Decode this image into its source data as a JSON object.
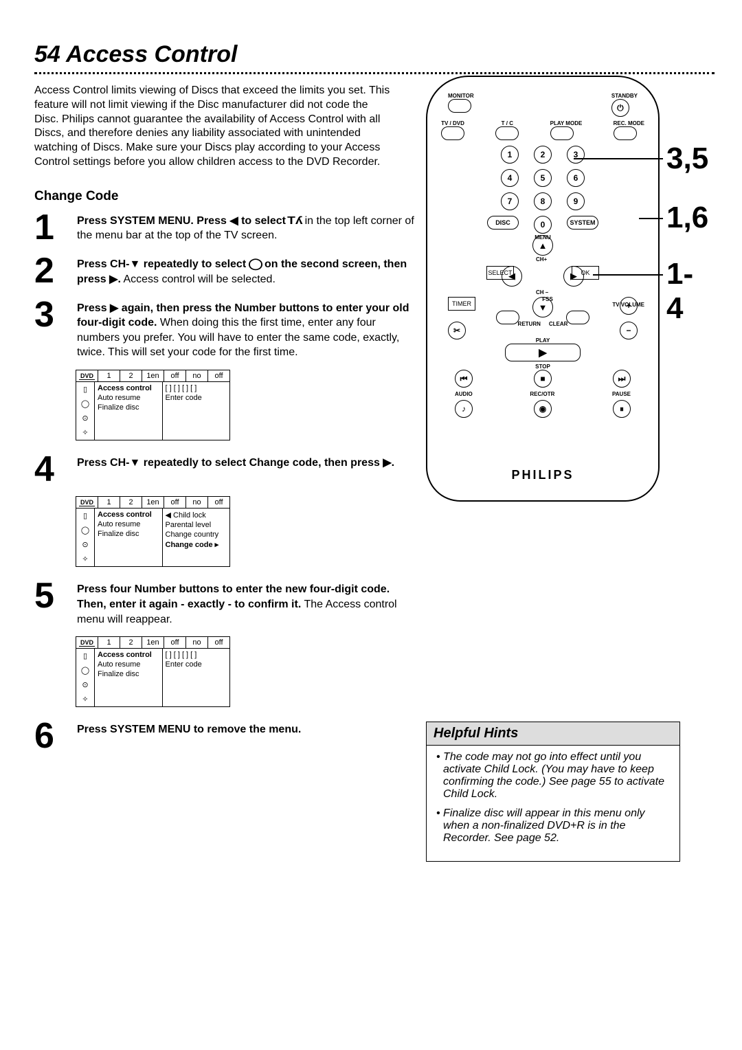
{
  "page": {
    "number": "54",
    "title": "Access Control",
    "intro": "Access Control limits viewing of Discs that exceed the limits you set. This feature will not limit viewing if the Disc manufacturer did not code the Disc. Philips cannot guarantee the availability of Access Control with all Discs, and therefore denies any liability associated with unintended watching of Discs. Make sure your Discs play according to your Access Control settings before you allow children access to the DVD Recorder.",
    "subtitle": "Change Code"
  },
  "steps": {
    "1": {
      "bold": "Press SYSTEM MENU. Press ◀ to select",
      "tail": " in the top left corner of the menu bar at the top of the TV screen."
    },
    "2": {
      "bold": "Press CH-▼ repeatedly to select",
      "tail2": "on the second screen, then press ▶.",
      "tail3": " Access control will be selected."
    },
    "3": {
      "bold": "Press ▶ again, then press the Number buttons to enter your old four-digit code.",
      "tail": " When doing this the first time, enter any four numbers you prefer. You will have to enter the same code, exactly, twice. This will set your code for the first time."
    },
    "4": {
      "bold": "Press CH-▼ repeatedly to select Change code, then press ▶."
    },
    "5": {
      "bold": "Press four Number buttons to enter the new four-digit code. Then, enter it again - exactly - to confirm it.",
      "tail": " The Access control menu will reappear."
    },
    "6": {
      "bold": "Press SYSTEM MENU to remove the menu."
    }
  },
  "osd": {
    "tabs": [
      "1",
      "2",
      "1en",
      "off",
      "no",
      "off"
    ],
    "items": [
      "Access control",
      "Auto resume",
      "Finalize disc"
    ],
    "entercode": "Enter code",
    "submenu": [
      "Child lock",
      "Parental level",
      "Change country",
      "Change code"
    ]
  },
  "remote": {
    "labels": {
      "monitor": "MONITOR",
      "standby": "STANDBY",
      "tvdvd": "TV / DVD",
      "tc": "T / C",
      "playmode": "PLAY MODE",
      "recmode": "REC. MODE",
      "disc": "DISC",
      "system": "SYSTEM",
      "menu": "MENU",
      "select": "SELECT",
      "ok": "OK",
      "chplus": "CH+",
      "chminus": "CH –",
      "timer": "TIMER",
      "fss": "FSS",
      "tvvolume": "TV VOLUME",
      "return": "RETURN",
      "clear": "CLEAR",
      "play": "PLAY",
      "stop": "STOP",
      "audio": "AUDIO",
      "recotr": "REC/OTR",
      "pause": "PAUSE"
    },
    "brand": "PHILIPS"
  },
  "callouts": {
    "a": "3,5",
    "b": "1,6",
    "c": "1-4"
  },
  "hints": {
    "title": "Helpful Hints",
    "items": [
      "The code may not go into effect until you activate Child Lock. (You may have to keep confirming the code.) See page 55 to activate Child Lock.",
      "Finalize disc will appear in this menu only when a non-finalized DVD+R is in the Recorder. See page 52."
    ]
  }
}
